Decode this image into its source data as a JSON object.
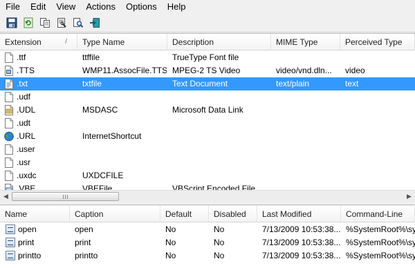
{
  "menu": [
    "File",
    "Edit",
    "View",
    "Actions",
    "Options",
    "Help"
  ],
  "toolbar": [
    {
      "icon": "save-icon",
      "tip": "Save"
    },
    {
      "icon": "refresh-icon",
      "tip": "Refresh"
    },
    {
      "icon": "copy-icon",
      "tip": "Copy"
    },
    {
      "icon": "properties-icon",
      "tip": "Properties"
    },
    {
      "icon": "find-icon",
      "tip": "Find"
    },
    {
      "icon": "exit-icon",
      "tip": "Exit"
    }
  ],
  "extensions": {
    "columns": [
      "Extension",
      "Type Name",
      "Description",
      "MIME Type",
      "Perceived Type"
    ],
    "sort_glyph": "/",
    "rows": [
      {
        "ext": ".ttf",
        "type": "ttffile",
        "desc": "TrueType Font file",
        "mime": "",
        "perceived": "",
        "icon": "blank-file-icon"
      },
      {
        "ext": ".TTS",
        "type": "WMP11.AssocFile.TTS",
        "desc": "MPEG-2 TS Video",
        "mime": "video/vnd.dln...",
        "perceived": "video",
        "icon": "video-file-icon"
      },
      {
        "ext": ".txt",
        "type": "txtfile",
        "desc": "Text Document",
        "mime": "text/plain",
        "perceived": "text",
        "icon": "text-file-icon",
        "selected": true
      },
      {
        "ext": ".udf",
        "type": "",
        "desc": "",
        "mime": "",
        "perceived": "",
        "icon": "blank-file-icon"
      },
      {
        "ext": ".UDL",
        "type": "MSDASC",
        "desc": "Microsoft Data Link",
        "mime": "",
        "perceived": "",
        "icon": "data-link-icon"
      },
      {
        "ext": ".udt",
        "type": "",
        "desc": "",
        "mime": "",
        "perceived": "",
        "icon": "blank-file-icon"
      },
      {
        "ext": ".URL",
        "type": "InternetShortcut",
        "desc": "",
        "mime": "",
        "perceived": "",
        "icon": "globe-icon"
      },
      {
        "ext": ".user",
        "type": "",
        "desc": "",
        "mime": "",
        "perceived": "",
        "icon": "blank-file-icon"
      },
      {
        "ext": ".usr",
        "type": "",
        "desc": "",
        "mime": "",
        "perceived": "",
        "icon": "blank-file-icon"
      },
      {
        "ext": ".uxdc",
        "type": "UXDCFILE",
        "desc": "",
        "mime": "",
        "perceived": "",
        "icon": "blank-file-icon"
      },
      {
        "ext": ".VBE",
        "type": "VBEFile",
        "desc": "VBScript Encoded File",
        "mime": "",
        "perceived": "",
        "icon": "script-file-icon"
      }
    ]
  },
  "scrollbar": {
    "left_arrow": "◀",
    "right_arrow": "▶"
  },
  "actions": {
    "columns": [
      "Name",
      "Caption",
      "Default",
      "Disabled",
      "Last Modified",
      "Command-Line"
    ],
    "rows": [
      {
        "name": "open",
        "caption": "open",
        "default": "No",
        "disabled": "No",
        "modified": "7/13/2009 10:53:38...",
        "cmd": "%SystemRoot%\\sys"
      },
      {
        "name": "print",
        "caption": "print",
        "default": "No",
        "disabled": "No",
        "modified": "7/13/2009 10:53:38...",
        "cmd": "%SystemRoot%\\sys"
      },
      {
        "name": "printto",
        "caption": "printto",
        "default": "No",
        "disabled": "No",
        "modified": "7/13/2009 10:53:38...",
        "cmd": "%SystemRoot%\\sys"
      }
    ]
  },
  "colors": {
    "selection": "#3399ff",
    "header_border": "#d5d5d5",
    "window": "#f0f0f0"
  }
}
